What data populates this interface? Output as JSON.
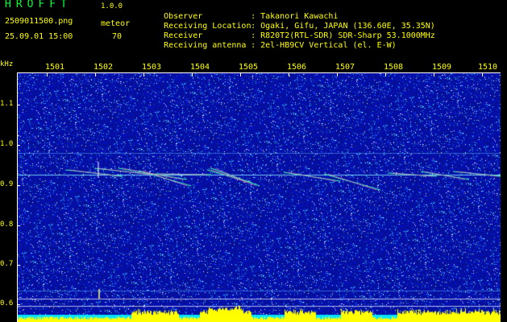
{
  "header": {
    "app_title": "HROFFT",
    "version": "1.0.0",
    "file_name": "2509011500.png",
    "mode": "meteor",
    "date_time": "25.09.01 15:00",
    "count": "70"
  },
  "info": [
    {
      "label": "Observer",
      "value": "Takanori Kawachi"
    },
    {
      "label": "Receiving Location",
      "value": "Ogaki, Gifu, JAPAN (136.60E, 35.35N)"
    },
    {
      "label": "Receiver",
      "value": "R820T2(RTL-SDR) SDR-Sharp 53.1000MHz"
    },
    {
      "label": "Receiving antenna",
      "value": "2el-HB9CV Vertical (el. E-W)"
    }
  ],
  "axis": {
    "y_unit": "kHz",
    "y_ticks": [
      "1.1",
      "1.0",
      "0.9",
      "0.8",
      "0.7",
      "0.6"
    ],
    "x_ticks": [
      "1501",
      "1502",
      "1503",
      "1504",
      "1505",
      "1506",
      "1507",
      "1508",
      "1509",
      "1510"
    ]
  },
  "colors": {
    "background": "#000000",
    "noise_blue": "#0a1ac8",
    "text_yellow": "#ffff00",
    "title_green": "#00ff33",
    "histogram_yellow": "#ffff00",
    "histogram_cyan": "#00e5ff"
  }
}
